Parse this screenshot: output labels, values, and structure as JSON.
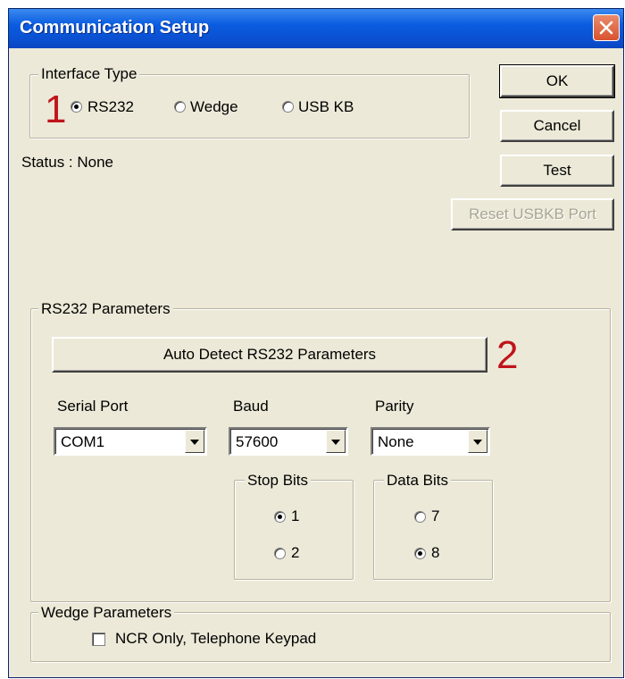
{
  "window": {
    "title": "Communication Setup"
  },
  "interface_type": {
    "legend": "Interface Type",
    "options": [
      {
        "label": "RS232",
        "checked": true
      },
      {
        "label": "Wedge",
        "checked": false
      },
      {
        "label": "USB KB",
        "checked": false
      }
    ]
  },
  "status": {
    "text": "Status : None"
  },
  "buttons": {
    "ok": "OK",
    "cancel": "Cancel",
    "test": "Test",
    "reset_usbkb": "Reset USBKB Port"
  },
  "rs232": {
    "legend": "RS232 Parameters",
    "auto_detect_label": "Auto Detect RS232 Parameters",
    "serial_port": {
      "label": "Serial Port",
      "value": "COM1"
    },
    "baud": {
      "label": "Baud",
      "value": "57600"
    },
    "parity": {
      "label": "Parity",
      "value": "None"
    },
    "stop_bits": {
      "legend": "Stop Bits",
      "options": [
        {
          "label": "1",
          "checked": true
        },
        {
          "label": "2",
          "checked": false
        }
      ]
    },
    "data_bits": {
      "legend": "Data Bits",
      "options": [
        {
          "label": "7",
          "checked": false
        },
        {
          "label": "8",
          "checked": true
        }
      ]
    }
  },
  "wedge": {
    "legend": "Wedge Parameters",
    "ncr_label": "NCR Only, Telephone Keypad",
    "ncr_checked": false
  },
  "annotations": {
    "marker_1": "1",
    "marker_2": "2"
  },
  "colors": {
    "title_bar": "#0a4fd0",
    "dialog_bg": "#ece9d8",
    "annotation": "#c0141b",
    "close_button": "#d9532f"
  },
  "icons": {
    "close": "close-x-icon"
  }
}
